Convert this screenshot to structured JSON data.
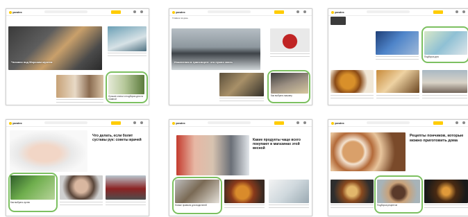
{
  "thumbnails": [
    {
      "logo": "yandex",
      "hero": "Человек под Морским музеем",
      "tile": "Лучшие статьи и подборки дня на главной"
    },
    {
      "logo": "yandex",
      "section": "Главное за день",
      "hero": "Изменения в транспорте: что нужно знать",
      "tile": "Как выбрать машину"
    },
    {
      "logo": "yandex",
      "tile": "Подборка дня"
    },
    {
      "logo": "yandex",
      "hero": "Что делать, если болят суставы рук: советы врачей",
      "tile": "Как выбрать кухню"
    },
    {
      "logo": "yandex",
      "hero": "Какие продукты чаще всего покупают в магазинах этой весной",
      "tile": "Новые правила для водителей"
    },
    {
      "logo": "yandex",
      "hero": "Рецепты пончиков, которые можно приготовить дома",
      "tile": "Подборка рецептов"
    }
  ],
  "colors": {
    "accent": "#ffcc00",
    "highlight": "#7cc060"
  }
}
